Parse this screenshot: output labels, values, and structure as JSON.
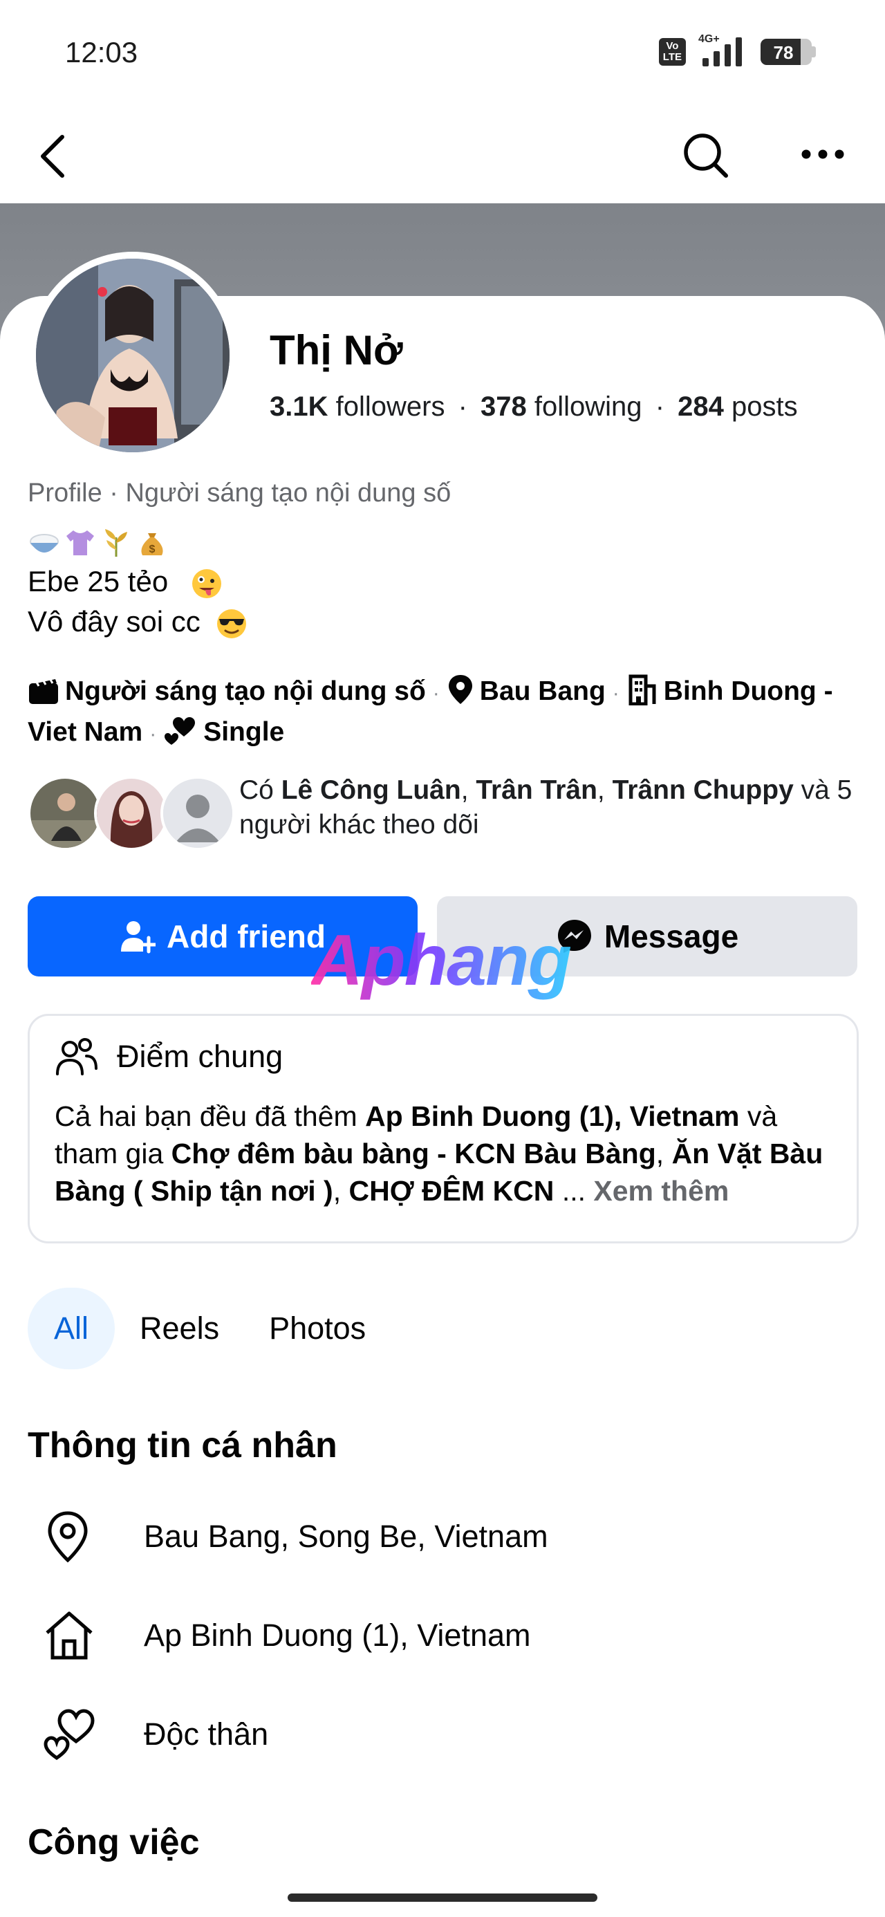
{
  "status_bar": {
    "time": "12:03",
    "volte_line1": "Vo",
    "volte_line2": "LTE",
    "network": "4G+",
    "battery": "78",
    "battery_level": 0.78
  },
  "nav": {
    "back_icon": "chevron-left-icon",
    "search_icon": "search-icon",
    "more_icon": "more-dots-icon"
  },
  "profile": {
    "name": "Thị Nở",
    "followers_count": "3.1K",
    "followers_label": "followers",
    "following_count": "378",
    "following_label": "following",
    "posts_count": "284",
    "posts_label": "posts",
    "category": "Profile · Người sáng tạo nội dung số",
    "bio_line1": "Ebe 25 tẻo",
    "bio_line2": "Vô đây soi cc"
  },
  "details": {
    "work": "Người sáng tạo nội dung số",
    "location": "Bau Bang",
    "hometown": "Binh Duong - Viet Nam",
    "relationship": "Single"
  },
  "mutual": {
    "prefix": "Có",
    "name1": "Lê Công Luân",
    "name2": "Trân Trân",
    "name3": "Trânn Chuppy",
    "suffix": "và 5 người khác theo dõi"
  },
  "buttons": {
    "add_friend": "Add friend",
    "message": "Message"
  },
  "watermark": "Aphang",
  "common": {
    "title": "Điểm chung",
    "text1": "Cả hai bạn đều đã thêm",
    "place": "Ap Binh Duong (1), Vietnam",
    "text2": "và tham gia",
    "group1": "Chợ đêm bàu bàng - KCN Bàu Bàng",
    "group2": "Ăn Vặt Bàu Bàng ( Ship tận nơi )",
    "group3": "CHỢ ĐÊM KCN",
    "ellipsis": "...",
    "see_more": "Xem thêm"
  },
  "tabs": [
    "All",
    "Reels",
    "Photos"
  ],
  "personal_info": {
    "title": "Thông tin cá nhân",
    "items": [
      {
        "icon": "location-pin-icon",
        "text": "Bau Bang, Song Be, Vietnam"
      },
      {
        "icon": "home-icon",
        "text": "Ap Binh Duong (1), Vietnam"
      },
      {
        "icon": "hearts-icon",
        "text": "Độc thân"
      }
    ]
  },
  "work_section": {
    "title": "Công việc"
  }
}
